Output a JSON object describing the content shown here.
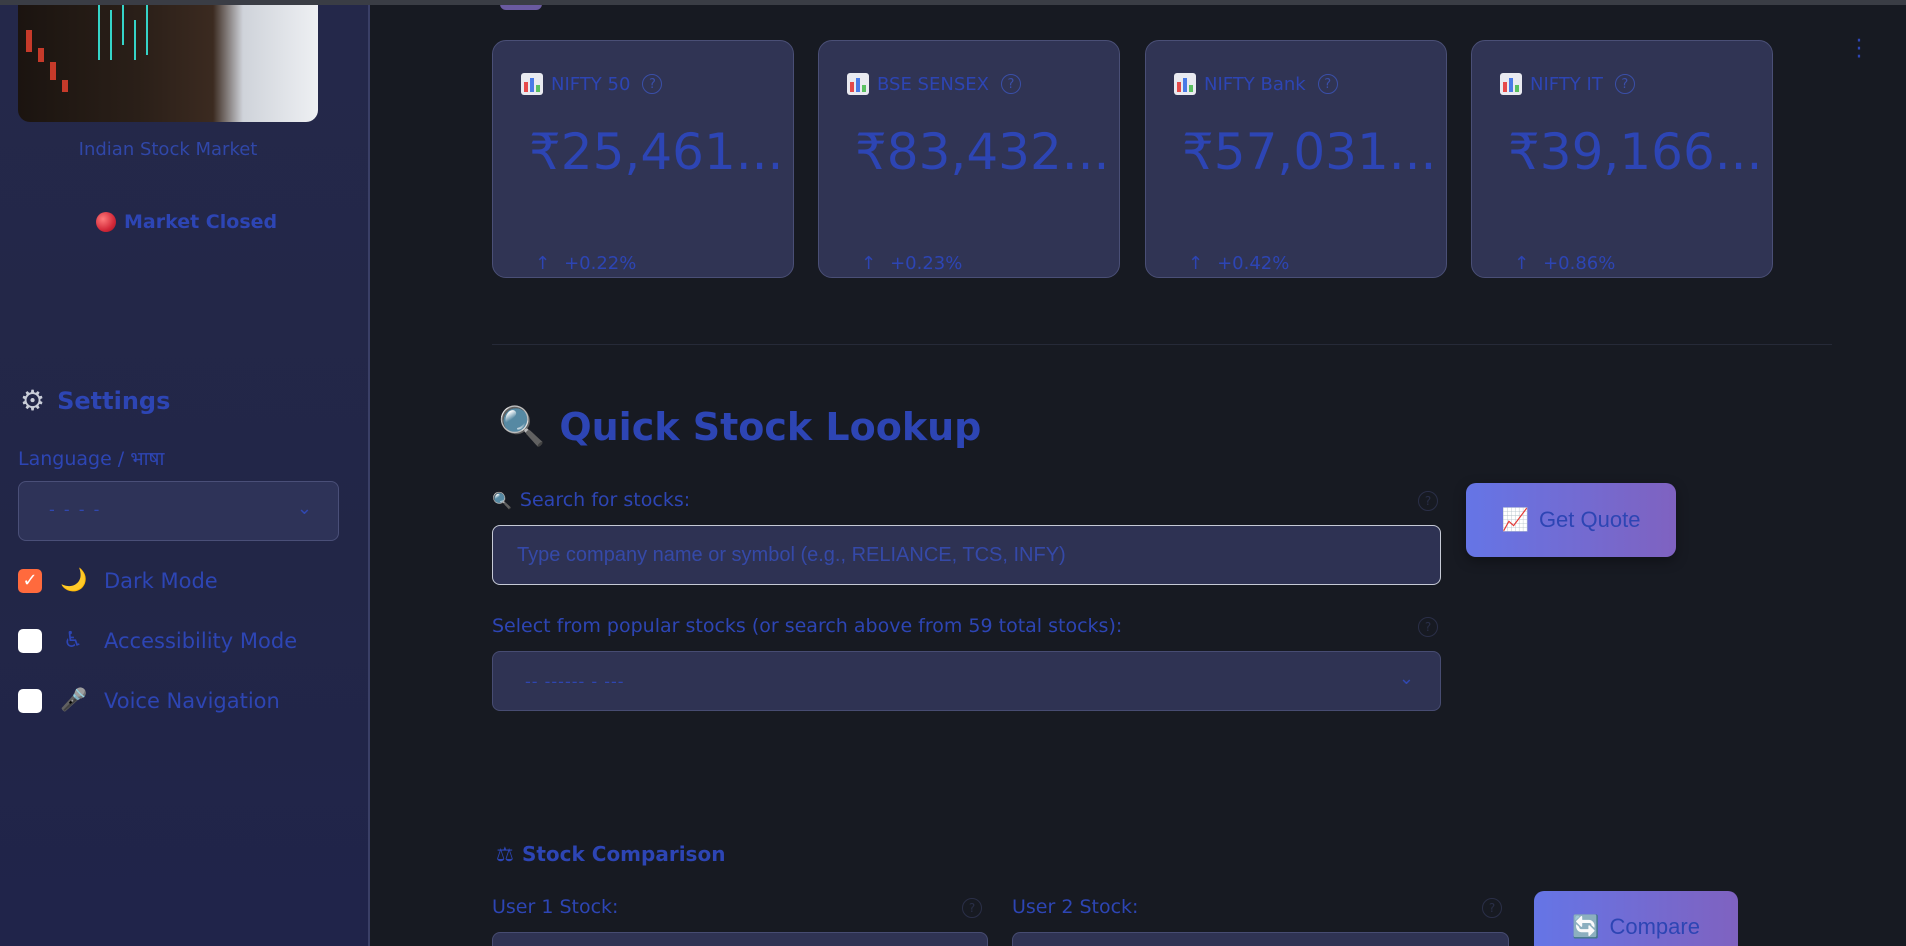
{
  "sidebar": {
    "caption": "Indian Stock Market",
    "market_status": "Market Closed",
    "settings_title": "Settings",
    "language_label": "Language / भाषा",
    "language_value": "- - - -",
    "toggles": [
      {
        "label": "Dark Mode",
        "icon": "moon-icon",
        "checked": true
      },
      {
        "label": "Accessibility Mode",
        "icon": "wheelchair-icon",
        "checked": false
      },
      {
        "label": "Voice Navigation",
        "icon": "microphone-icon",
        "checked": false
      }
    ]
  },
  "indices": [
    {
      "name": "NIFTY 50",
      "value": "₹25,461...",
      "change": "+0.22%"
    },
    {
      "name": "BSE SENSEX",
      "value": "₹83,432...",
      "change": "+0.23%"
    },
    {
      "name": "NIFTY Bank",
      "value": "₹57,031...",
      "change": "+0.42%"
    },
    {
      "name": "NIFTY IT",
      "value": "₹39,166...",
      "change": "+0.86%"
    }
  ],
  "lookup": {
    "title": "Quick Stock Lookup",
    "search_label": "Search for stocks:",
    "search_placeholder": "Type company name or symbol (e.g., RELIANCE, TCS, INFY)",
    "get_quote_label": "Get Quote",
    "popular_label": "Select from popular stocks (or search above from 59 total stocks):",
    "popular_value": "-- ------ - ---"
  },
  "comparison": {
    "title": "Stock Comparison",
    "user1_label": "User 1 Stock:",
    "user2_label": "User 2 Stock:",
    "compare_label": "Compare"
  },
  "colors": {
    "accent_text": "#2d45b4",
    "button_gradient_start": "#6575e6",
    "button_gradient_end": "#7f62c0",
    "checkbox_checked": "#ff6a3d"
  }
}
